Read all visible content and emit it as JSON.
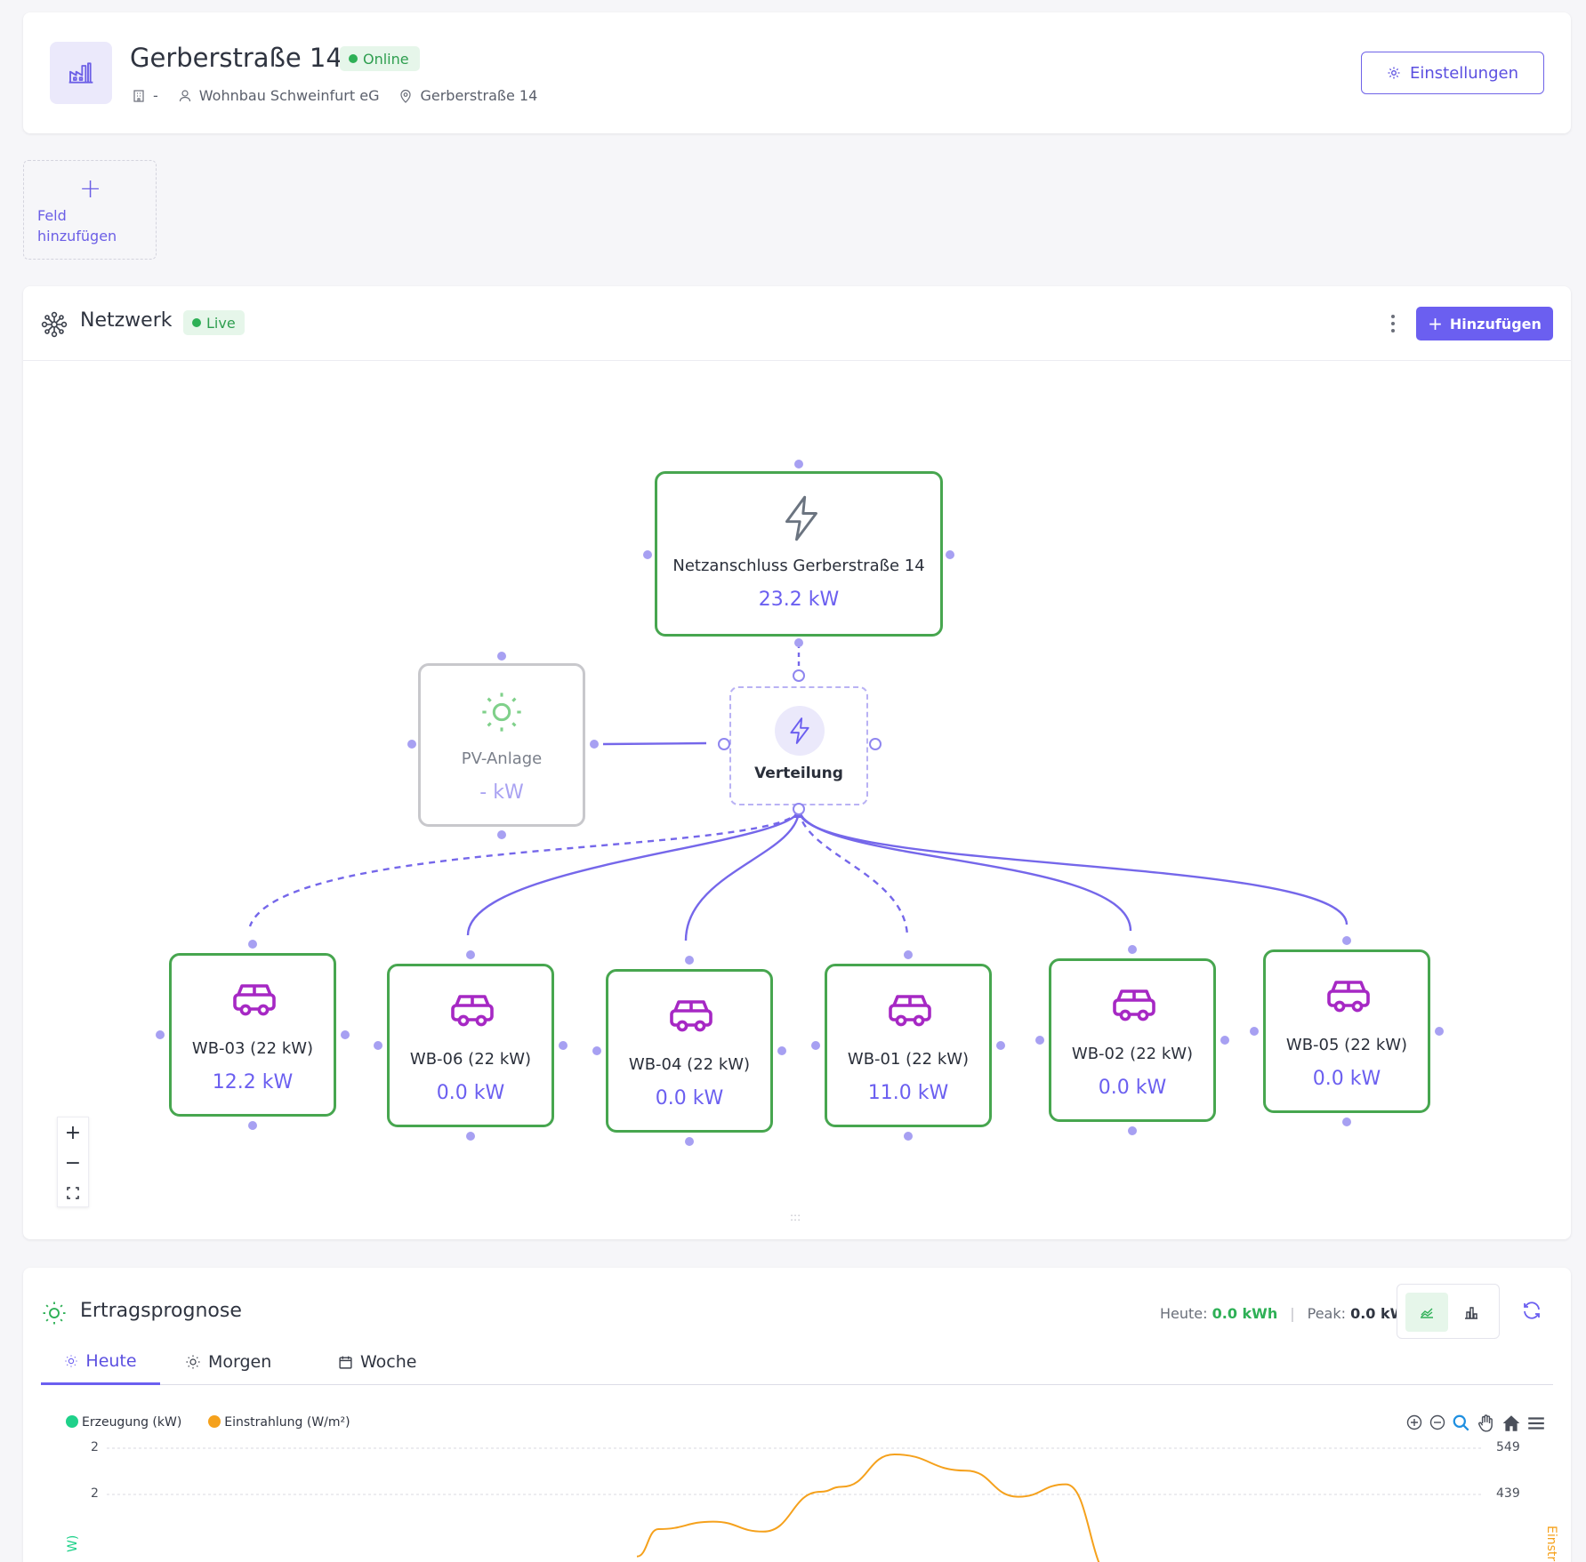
{
  "header": {
    "title": "Gerberstraße 14",
    "status": "Online",
    "building": "-",
    "owner": "Wohnbau Schweinfurt eG",
    "address": "Gerberstraße 14",
    "settings_label": "Einstellungen"
  },
  "add_field": {
    "label": "Feld hinzufügen"
  },
  "network": {
    "title": "Netzwerk",
    "live": "Live",
    "add_label": "Hinzufügen",
    "grid": {
      "label": "Netzanschluss Gerberstraße 14",
      "value": "23.2 kW"
    },
    "pv": {
      "label": "PV-Anlage",
      "value": "- kW"
    },
    "distribution": {
      "label": "Verteilung"
    },
    "chargers": [
      {
        "label": "WB-03 (22 kW)",
        "value": "12.2 kW"
      },
      {
        "label": "WB-06 (22 kW)",
        "value": "0.0 kW"
      },
      {
        "label": "WB-04 (22 kW)",
        "value": "0.0 kW"
      },
      {
        "label": "WB-01 (22 kW)",
        "value": "11.0 kW"
      },
      {
        "label": "WB-02 (22 kW)",
        "value": "0.0 kW"
      },
      {
        "label": "WB-05 (22 kW)",
        "value": "0.0 kW"
      }
    ],
    "zoom": {
      "in": "+",
      "out": "−"
    }
  },
  "forecast": {
    "title": "Ertragsprognose",
    "today_label": "Heute:",
    "today_value": "0.0 kWh",
    "peak_label": "Peak:",
    "peak_value": "0.0 kW",
    "tabs": [
      {
        "label": "Heute"
      },
      {
        "label": "Morgen"
      },
      {
        "label": "Woche"
      }
    ],
    "legend": [
      {
        "label": "Erzeugung (kW)",
        "color": "#1fd18a"
      },
      {
        "label": "Einstrahlung (W/m²)",
        "color": "#f5a11c"
      }
    ],
    "y_left_ticks": [
      "2",
      "2"
    ],
    "y_right_ticks": [
      "549",
      "439"
    ],
    "y_left_label": "W)",
    "y_right_label": "Einstr"
  },
  "chart_data": {
    "type": "line",
    "series": [
      {
        "name": "Einstrahlung (W/m²)",
        "values": [
          {
            "x": 0.0,
            "y": 0.18
          },
          {
            "x": 0.045,
            "y": 0.4
          },
          {
            "x": 0.16,
            "y": 0.46
          },
          {
            "x": 0.265,
            "y": 0.38
          },
          {
            "x": 0.385,
            "y": 0.7
          },
          {
            "x": 0.43,
            "y": 0.74
          },
          {
            "x": 0.54,
            "y": 1.0
          },
          {
            "x": 0.69,
            "y": 0.87
          },
          {
            "x": 0.8,
            "y": 0.66
          },
          {
            "x": 0.9,
            "y": 0.76
          },
          {
            "x": 1.0,
            "y": 0.0
          }
        ]
      }
    ]
  }
}
